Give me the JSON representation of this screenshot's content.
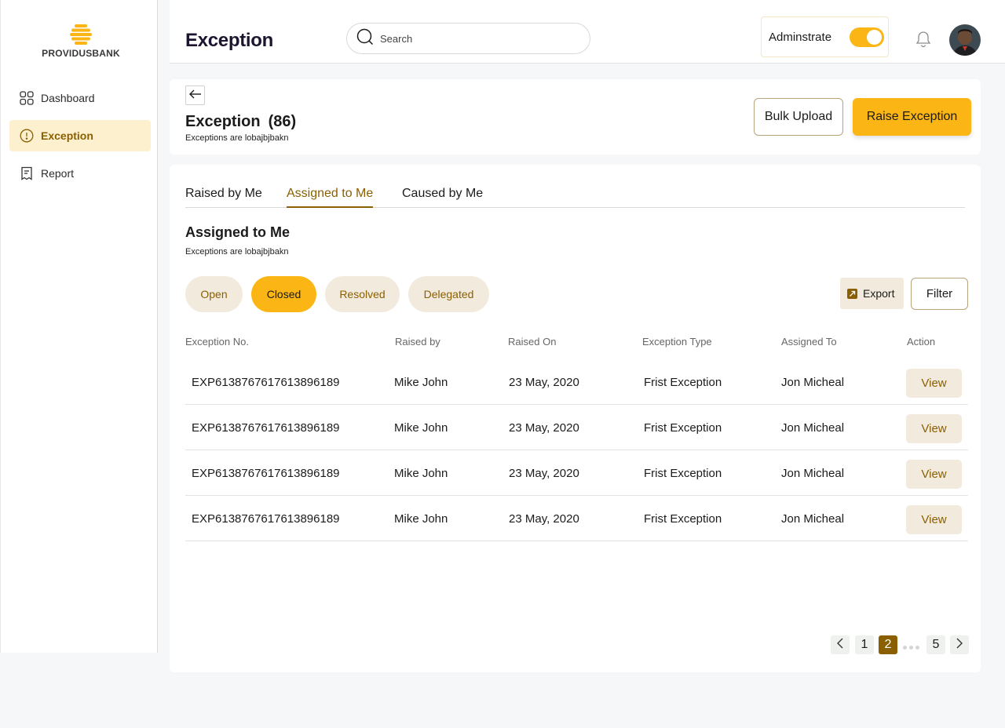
{
  "brand": {
    "name": "PROVIDUSBANK",
    "logo_color": "#fbb615"
  },
  "sidebar": {
    "items": [
      {
        "label": "Dashboard",
        "icon": "grid-icon",
        "active": false
      },
      {
        "label": "Exception",
        "icon": "alert-circle-icon",
        "active": true
      },
      {
        "label": "Report",
        "icon": "report-icon",
        "active": false
      }
    ]
  },
  "header": {
    "title": "Exception",
    "search_placeholder": "Search",
    "admin_label": "Adminstrate",
    "admin_toggle_on": true
  },
  "exception_card": {
    "title": "Exception",
    "count": "(86)",
    "subtitle": "Exceptions are lobajbjbakn",
    "bulk_upload_label": "Bulk Upload",
    "raise_label": "Raise Exception"
  },
  "tabs": [
    "Raised by Me",
    "Assigned to Me",
    "Caused by Me"
  ],
  "active_tab": "Assigned to Me",
  "section": {
    "title": "Assigned to Me",
    "subtitle": "Exceptions are lobajbjbakn"
  },
  "status_filters": [
    "Open",
    "Closed",
    "Resolved",
    "Delegated"
  ],
  "active_status": "Closed",
  "actions": {
    "export_label": "Export",
    "filter_label": "Filter"
  },
  "table": {
    "columns": [
      "Exception No.",
      "Raised by",
      "Raised On",
      "Exception Type",
      "Assigned To",
      "Action"
    ],
    "rows": [
      {
        "exception_no": "EXP6138767617613896189",
        "raised_by": "Mike John",
        "raised_on": "23 May, 2020",
        "type": "Frist Exception",
        "assigned_to": "Jon Micheal",
        "action": "View"
      },
      {
        "exception_no": "EXP6138767617613896189",
        "raised_by": "Mike John",
        "raised_on": "23 May, 2020",
        "type": "Frist Exception",
        "assigned_to": "Jon Micheal",
        "action": "View"
      },
      {
        "exception_no": "EXP6138767617613896189",
        "raised_by": "Mike John",
        "raised_on": "23 May, 2020",
        "type": "Frist Exception",
        "assigned_to": "Jon Micheal",
        "action": "View"
      },
      {
        "exception_no": "EXP6138767617613896189",
        "raised_by": "Mike John",
        "raised_on": "23 May, 2020",
        "type": "Frist Exception",
        "assigned_to": "Jon Micheal",
        "action": "View"
      }
    ]
  },
  "pagination": {
    "pages": [
      "1",
      "2",
      "5"
    ],
    "current": "2"
  },
  "colors": {
    "accent": "#fbb615",
    "accent_dark": "#8a5f00",
    "pill_bg": "#f2ebdd"
  }
}
